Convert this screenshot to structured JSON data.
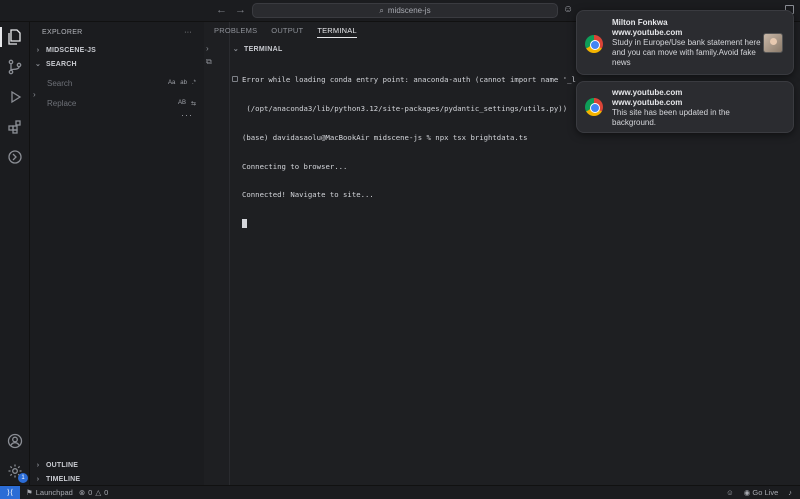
{
  "titlebar": {
    "search_text": "midscene-js"
  },
  "sidebar": {
    "header": "EXPLORER",
    "header_more": "···",
    "sections": {
      "project": "MIDSCENE-JS",
      "search": "SEARCH",
      "outline": "OUTLINE",
      "timeline": "TIMELINE"
    },
    "search": {
      "search_placeholder": "Search",
      "replace_placeholder": "Replace",
      "match_case": "Aa",
      "whole_word": "ab",
      "regex": ".*",
      "preserve_case": "AB"
    }
  },
  "panel": {
    "tabs": [
      "PROBLEMS",
      "OUTPUT",
      "TERMINAL"
    ],
    "active_tab": "TERMINAL",
    "terminal_header": "TERMINAL",
    "lines": [
      "Error while loading conda entry point: anaconda-auth (cannot import name '_l",
      " (/opt/anaconda3/lib/python3.12/site-packages/pydantic_settings/utils.py))",
      "(base) davidasaolu@MacBookAir midscene-js % npx tsx brightdata.ts",
      "Connecting to browser...",
      "Connected! Navigate to site..."
    ]
  },
  "statusbar": {
    "launchpad": "Launchpad",
    "errors": "0",
    "warnings": "0",
    "go_live": "Go Live"
  },
  "activity": {
    "accounts_badge": "1"
  },
  "notifications": [
    {
      "title": "Milton Fonkwa",
      "source": "www.youtube.com",
      "body": "Study in Europe/Use bank statement here and you can move with family.Avoid fake news"
    },
    {
      "title": "www.youtube.com",
      "source": "www.youtube.com",
      "body": "This site has been updated in the background."
    }
  ],
  "icons": {
    "activity": [
      "files-icon",
      "source-control-icon",
      "run-debug-icon",
      "extensions-icon",
      "remote-explorer-icon",
      "account-icon",
      "settings-gear-icon"
    ]
  },
  "colors": {
    "accent": "#2b6cd6",
    "background": "#1e1f22"
  }
}
